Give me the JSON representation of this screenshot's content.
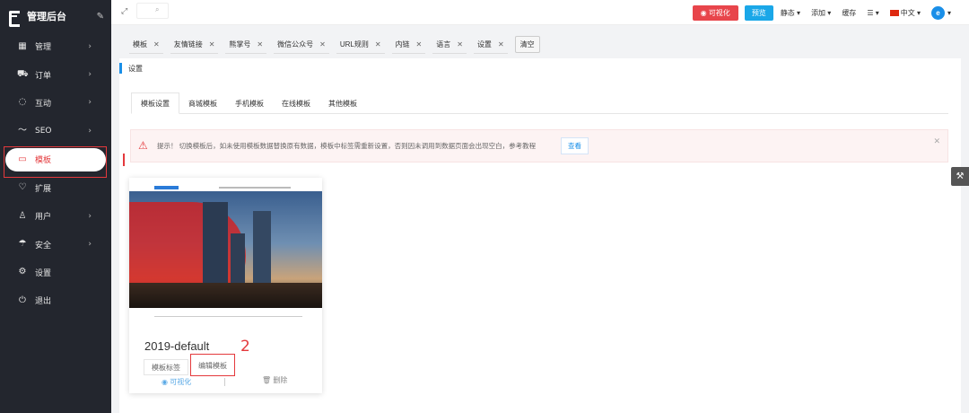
{
  "app": {
    "title": "管理后台"
  },
  "sidebar": {
    "items": [
      {
        "label": "管理",
        "has_arrow": true
      },
      {
        "label": "订单",
        "has_arrow": true
      },
      {
        "label": "互动",
        "has_arrow": true
      },
      {
        "label": "SEO",
        "has_arrow": true
      },
      {
        "label": "模板",
        "active": true
      },
      {
        "label": "扩展"
      },
      {
        "label": "用户",
        "has_arrow": true
      },
      {
        "label": "安全",
        "has_arrow": true
      },
      {
        "label": "设置"
      },
      {
        "label": "退出"
      }
    ]
  },
  "topbar": {
    "visual_button": "可视化",
    "preview_button": "预览",
    "static_menu": "静态",
    "add_menu": "添加",
    "cache_link": "缓存",
    "language": "中文"
  },
  "tabs": [
    "模板",
    "友情链接",
    "熊掌号",
    "微信公众号",
    "URL规则",
    "内链",
    "语言",
    "设置"
  ],
  "tabs_clear": "清空",
  "breadcrumb": "设置",
  "subtabs": [
    "模板设置",
    "商城模板",
    "手机模板",
    "在线模板",
    "其他模板"
  ],
  "alert": {
    "text": "提示！ 切换模板后，如未使用模板数据替换原有数据，模板中标签需重新设置，否则因未调用到数据页面会出现空白，参考教程",
    "button": "查看"
  },
  "template_card": {
    "name": "2019-default",
    "tags_button": "模板标签",
    "edit_button": "编辑模板",
    "visual_action": "可视化",
    "delete_action": "删除"
  },
  "annotation_number": "2",
  "colors": {
    "sidebar_bg": "#23262e",
    "accent_red": "#e4393c",
    "accent_blue": "#1a8fe8"
  }
}
